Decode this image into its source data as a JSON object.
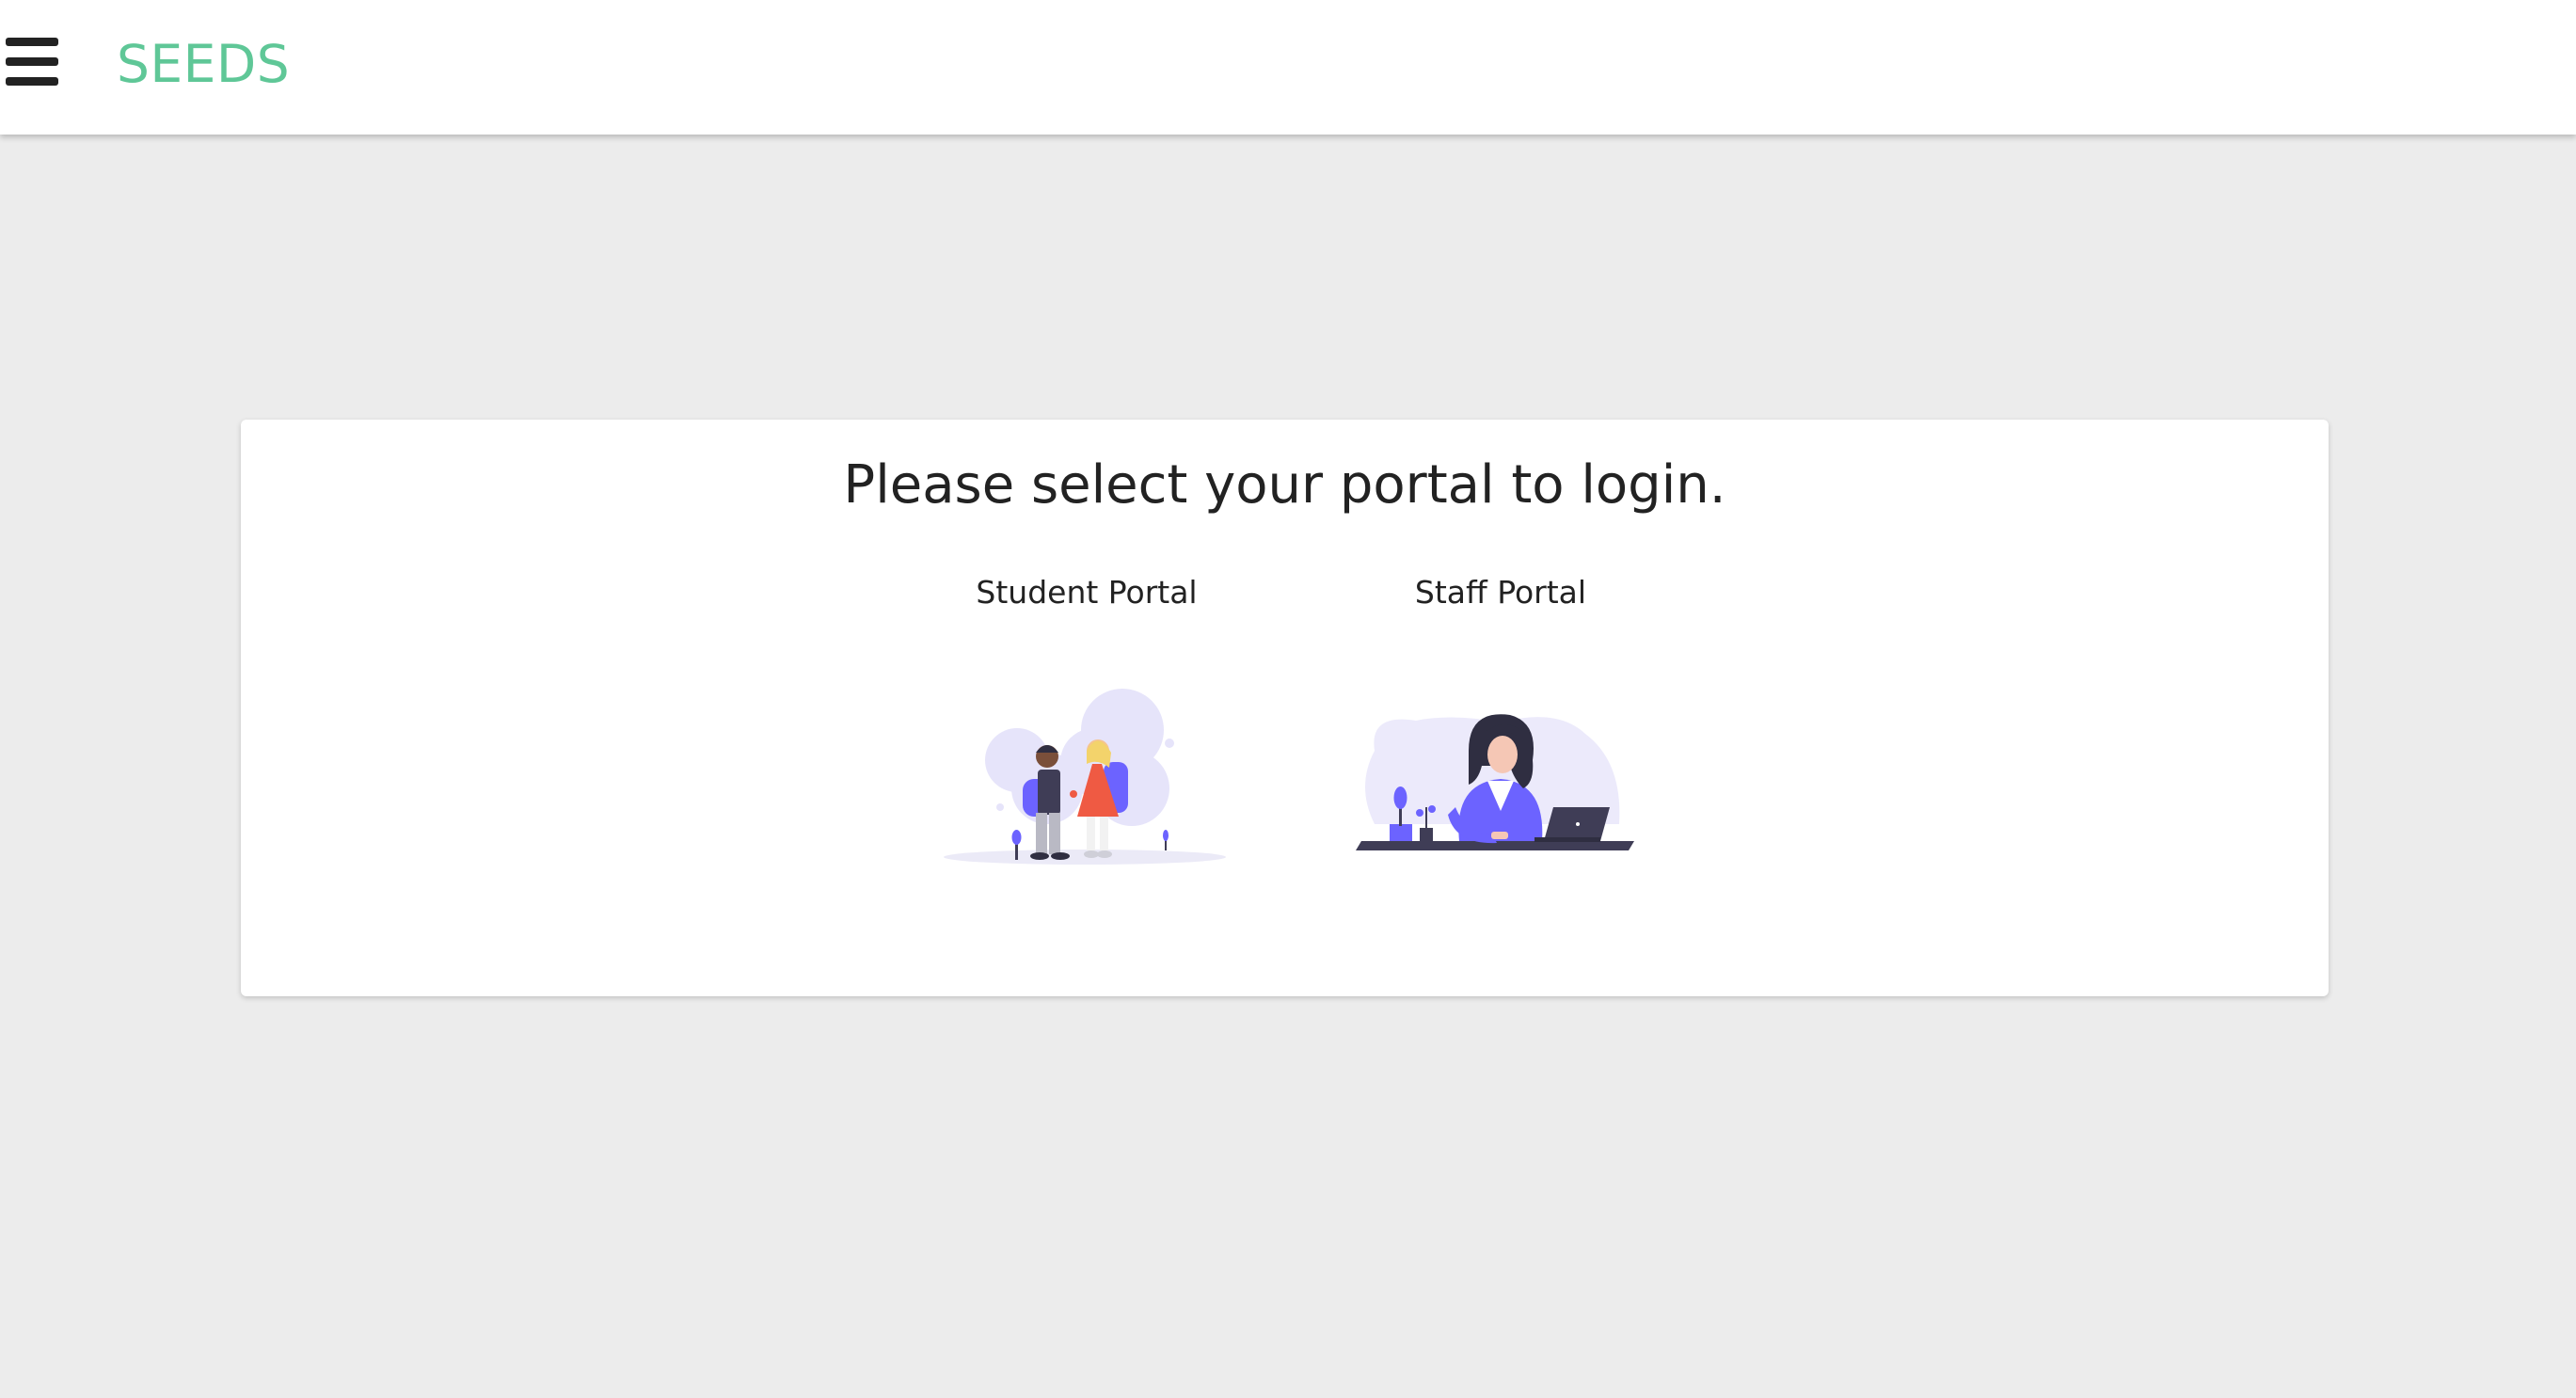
{
  "header": {
    "brand": "SEEDS",
    "menu_icon": "hamburger-menu-icon"
  },
  "login": {
    "title": "Please select your portal to login.",
    "portals": [
      {
        "label": "Student Portal",
        "illustration": "students-illustration"
      },
      {
        "label": "Staff Portal",
        "illustration": "staff-illustration"
      }
    ]
  },
  "colors": {
    "brand": "#5fc797",
    "accent": "#6c63ff",
    "background": "#ececec"
  }
}
